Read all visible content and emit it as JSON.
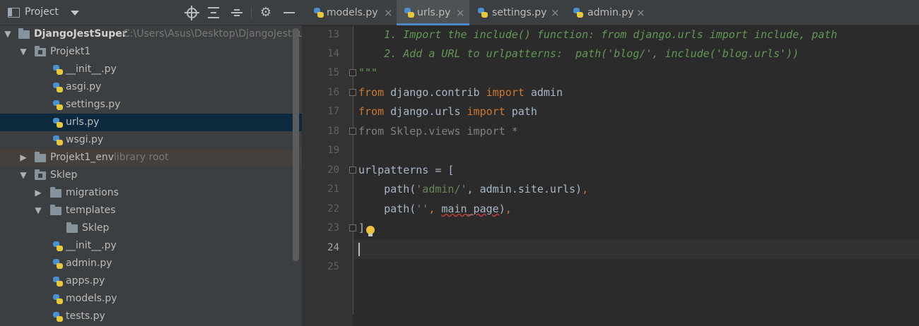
{
  "panel": {
    "title": "Project",
    "icons": [
      "project-window-icon",
      "dropdown-icon",
      "locate-icon",
      "expand-all-icon",
      "collapse-all-icon",
      "gear-icon",
      "hide-icon"
    ]
  },
  "tree": [
    {
      "label": "DjangoJestSuper",
      "hint": "C:\\Users\\Asus\\Desktop\\DjangoJestSup",
      "type": "folder",
      "expanded": true,
      "bold": true
    },
    {
      "label": "Projekt1",
      "type": "module",
      "expanded": true
    },
    {
      "label": "__init__.py",
      "type": "py"
    },
    {
      "label": "asgi.py",
      "type": "py"
    },
    {
      "label": "settings.py",
      "type": "py"
    },
    {
      "label": "urls.py",
      "type": "py",
      "selected": true
    },
    {
      "label": "wsgi.py",
      "type": "py"
    },
    {
      "label": "Projekt1_env",
      "hint": "library root",
      "type": "folder",
      "expanded": false
    },
    {
      "label": "Sklep",
      "type": "module",
      "expanded": true
    },
    {
      "label": "migrations",
      "type": "folder",
      "expanded": false
    },
    {
      "label": "templates",
      "type": "folder",
      "expanded": true
    },
    {
      "label": "Sklep",
      "type": "folder"
    },
    {
      "label": "__init__.py",
      "type": "py"
    },
    {
      "label": "admin.py",
      "type": "py"
    },
    {
      "label": "apps.py",
      "type": "py"
    },
    {
      "label": "models.py",
      "type": "py"
    },
    {
      "label": "tests.py",
      "type": "py"
    }
  ],
  "tabs": [
    {
      "label": "models.py",
      "active": false
    },
    {
      "label": "urls.py",
      "active": true
    },
    {
      "label": "settings.py",
      "active": false
    },
    {
      "label": "admin.py",
      "active": false
    }
  ],
  "tab_close_glyph": "×",
  "editor": {
    "current_line": "24",
    "line_numbers": [
      "13",
      "14",
      "15",
      "16",
      "17",
      "18",
      "19",
      "20",
      "21",
      "22",
      "23",
      "24",
      "25"
    ],
    "lines": {
      "l13": "    1. Import the include() function: from django.urls import include, path",
      "l14": "    2. Add a URL to urlpatterns:  path('blog/', include('blog.urls'))",
      "l15": "\"\"\"",
      "l16_kw1": "from",
      "l16_mod": " django.contrib ",
      "l16_kw2": "import",
      "l16_name": " admin",
      "l17_kw1": "from",
      "l17_mod": " django.urls ",
      "l17_kw2": "import",
      "l17_name": " path",
      "l18": "from Sklep.views import *",
      "l20": "urlpatterns = [",
      "l21_a": "    path(",
      "l21_str": "'admin/'",
      "l21_b": ", admin.site.urls)",
      "l21_comma": ",",
      "l22_a": "    path(",
      "l22_str": "''",
      "l22_comma1": ",",
      "l22_sp": " ",
      "l22_name": "main_page",
      "l22_close": ")",
      "l22_comma2": ",",
      "l23": "]"
    }
  },
  "colors": {
    "keyword": "#cc7832",
    "string": "#6a8759",
    "docstring": "#629755",
    "default": "#a9b7c6",
    "selection": "#0d293e"
  }
}
